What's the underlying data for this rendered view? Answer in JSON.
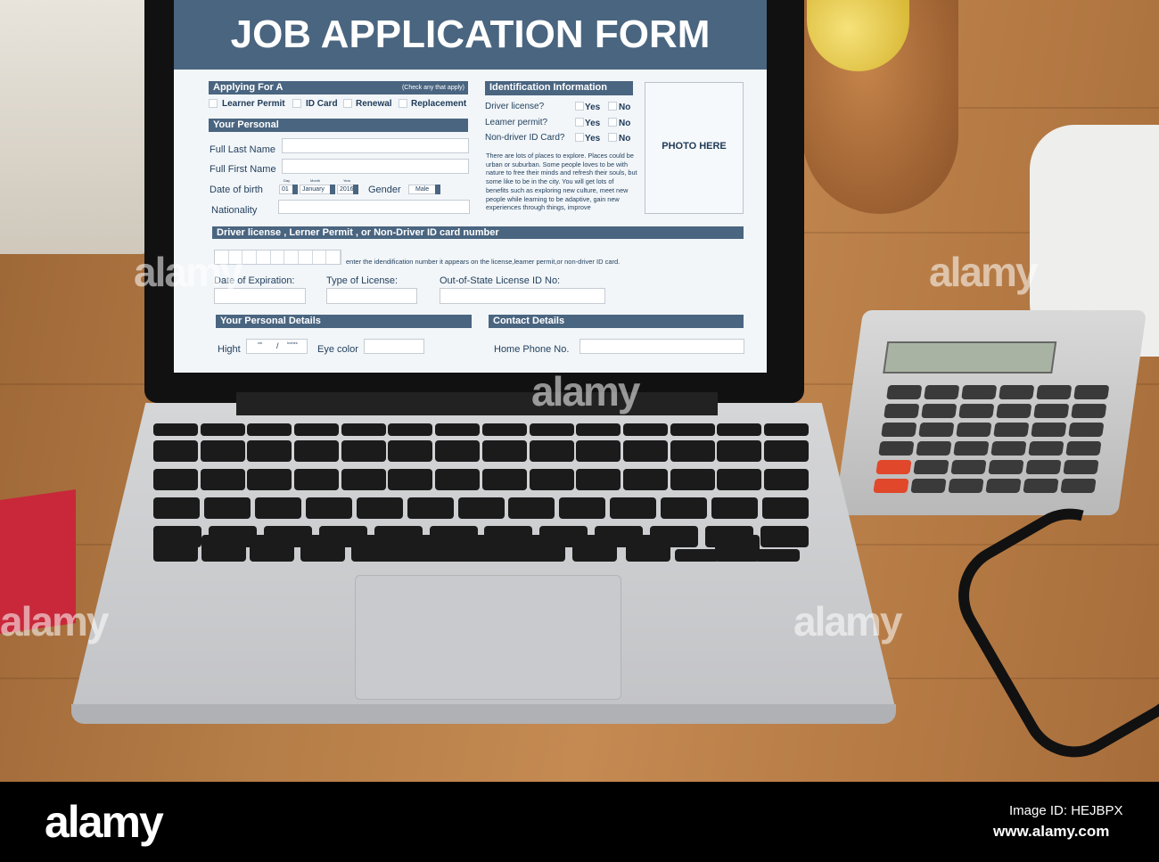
{
  "form": {
    "title": "JOB APPLICATION FORM",
    "applying_for": {
      "header": "Applying For A",
      "hint": "(Check any that apply)",
      "options": [
        "Learner Permit",
        "ID Card",
        "Renewal",
        "Replacement"
      ]
    },
    "personal": {
      "header": "Your Personal",
      "full_last_name": "Full Last Name",
      "full_first_name": "Full First Name",
      "date_of_birth": "Date of birth",
      "day_label": "Day",
      "month_label": "Month",
      "year_label": "Year",
      "day": "01",
      "month": "January",
      "year": "2016",
      "gender_label": "Gender",
      "gender": "Male",
      "nationality": "Nationality"
    },
    "identification": {
      "header": "Identification Information",
      "questions": [
        "Driver license?",
        "Leamer permit?",
        "Non-driver ID Card?"
      ],
      "yes": "Yes",
      "no": "No",
      "paragraph": "There are lots of places to explore. Places could be urban or suburban. Some people loves to be with nature to free their minds and refresh their souls, but some like to be in the city. You will get lots of benefits such as exploring new culture, meet new people while learning to be adaptive, gain new experiences through things, improve"
    },
    "photo": "PHOTO HERE",
    "license": {
      "header": "Driver license , Lerner Permit , or Non-Driver ID card number",
      "hint": "enter the idendification number it appears on the license,leamer permit,or non-driver ID card.",
      "date_of_expiration": "Date of Expiration:",
      "type_of_license": "Type of License:",
      "out_of_state": "Out-of-State License ID No:"
    },
    "personal_details": {
      "header": "Your Personal Details",
      "height": "Hight",
      "cm": "cm",
      "separator": "/",
      "inches": "Inches",
      "eye_color": "Eye color"
    },
    "contact": {
      "header": "Contact Details",
      "home_phone": "Home Phone No."
    }
  },
  "watermark": "alamy",
  "footer": {
    "logo": "alamy",
    "image_id": "Image ID: HEJBPX",
    "url": "www.alamy.com"
  },
  "colors": {
    "form_header": "#4a6580",
    "form_bg": "#f2f6f9",
    "wood": "#b57d47"
  }
}
